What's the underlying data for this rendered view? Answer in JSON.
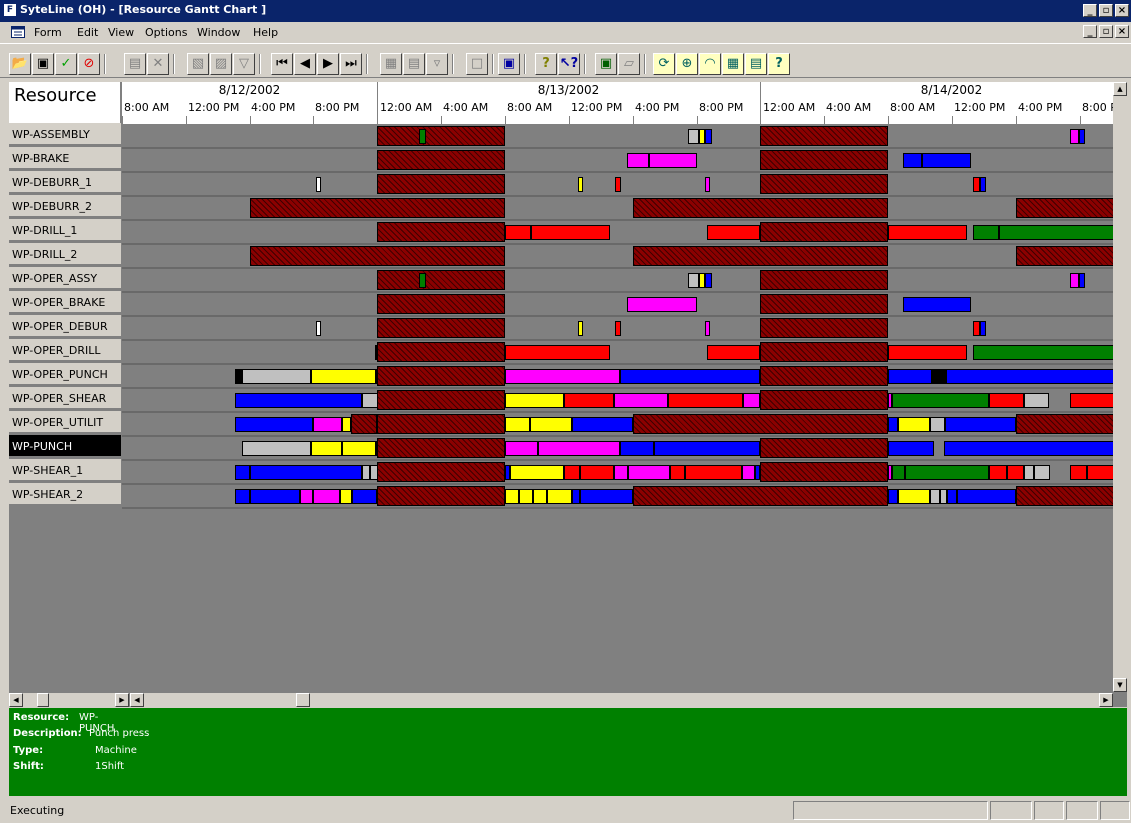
{
  "window": {
    "title": "SyteLine (OH) - [Resource Gantt Chart ]",
    "app_icon": "F"
  },
  "window_controls": [
    "_",
    "×"
  ],
  "menu": [
    "Form",
    "Edit",
    "View",
    "Options",
    "Window",
    "Help"
  ],
  "gantt": {
    "resource_header": "Resource",
    "dates": [
      "8/12/2002",
      "8/13/2002",
      "8/14/2002"
    ],
    "hour_labels": [
      "8:00 AM",
      "12:00 PM",
      "4:00 PM",
      "8:00 PM",
      "12:00 AM",
      "4:00 AM",
      "8:00 AM",
      "12:00 PM",
      "4:00 PM",
      "8:00 PM",
      "12:00 AM",
      "4:00 AM",
      "8:00 AM",
      "12:00 PM",
      "4:00 PM",
      "8:00 P"
    ],
    "colors": {
      "downtime": "#8b0000",
      "blue": "#0000ff",
      "yellow": "#ffff00",
      "magenta": "#ff00ff",
      "red": "#ff0000",
      "green": "#008000",
      "gray": "#c0c0c0",
      "white": "#ffffff",
      "black": "#000000"
    },
    "resources": [
      "WP-ASSEMBLY",
      "WP-BRAKE",
      "WP-DEBURR_1",
      "WP-DEBURR_2",
      "WP-DRILL_1",
      "WP-DRILL_2",
      "WP-OPER_ASSY",
      "WP-OPER_BRAKE",
      "WP-OPER_DEBUR",
      "WP-OPER_DRILL",
      "WP-OPER_PUNCH",
      "WP-OPER_SHEAR",
      "WP-OPER_UTILIT",
      "WP-PUNCH",
      "WP-SHEAR_1",
      "WP-SHEAR_2"
    ],
    "selected_resource": "WP-PUNCH"
  },
  "info": {
    "resource_label": "Resource:",
    "resource": "WP-PUNCH",
    "description_label": "Description:",
    "description": "Punch press",
    "type_label": "Type:",
    "type": "Machine",
    "shift_label": "Shift:",
    "shift": "1Shift"
  },
  "status": {
    "text": "Executing"
  }
}
